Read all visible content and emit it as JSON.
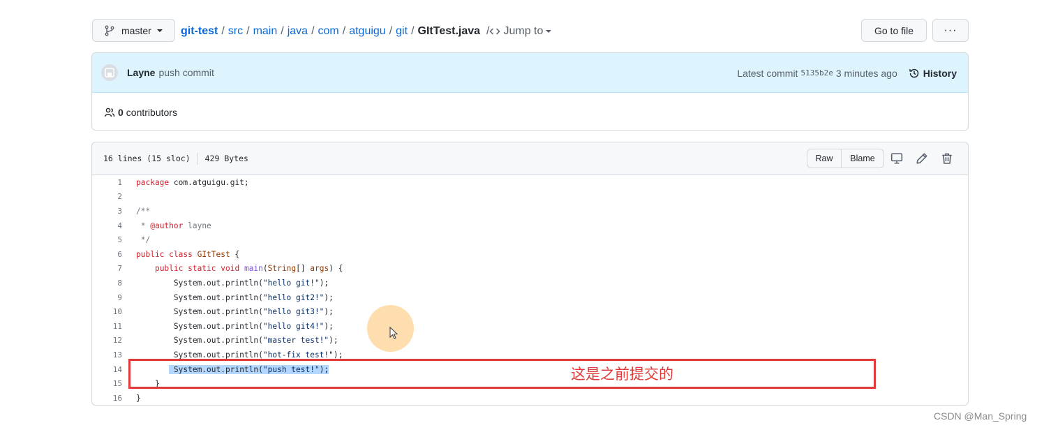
{
  "branch": {
    "name": "master"
  },
  "breadcrumb": {
    "repo": "git-test",
    "segments": [
      "src",
      "main",
      "java",
      "com",
      "atguigu",
      "git"
    ],
    "file": "GItTest.java",
    "jump_label": "Jump to"
  },
  "actions": {
    "goto_file": "Go to file",
    "more": "···"
  },
  "commit": {
    "author": "Layne",
    "message": "push commit",
    "latest_label": "Latest commit",
    "sha": "5135b2e",
    "time": "3 minutes ago",
    "history_label": "History"
  },
  "contributors": {
    "count": "0",
    "label": "contributors"
  },
  "file_info": {
    "lines": "16 lines (15 sloc)",
    "size": "429 Bytes",
    "raw": "Raw",
    "blame": "Blame"
  },
  "code_lines": [
    "package com.atguigu.git;",
    "",
    "/**",
    " * @author layne",
    " */",
    "public class GItTest {",
    "    public static void main(String[] args) {",
    "        System.out.println(\"hello git!\");",
    "        System.out.println(\"hello git2!\");",
    "        System.out.println(\"hello git3!\");",
    "        System.out.println(\"hello git4!\");",
    "        System.out.println(\"master test!\");",
    "        System.out.println(\"hot-fix test!\");",
    "        System.out.println(\"push test!\");",
    "    }",
    "}"
  ],
  "annotation": "这是之前提交的",
  "watermark": "CSDN @Man_Spring",
  "colors": {
    "link": "#0969da",
    "annotation_red": "#e03b3b",
    "commit_bg": "#ddf4ff"
  }
}
